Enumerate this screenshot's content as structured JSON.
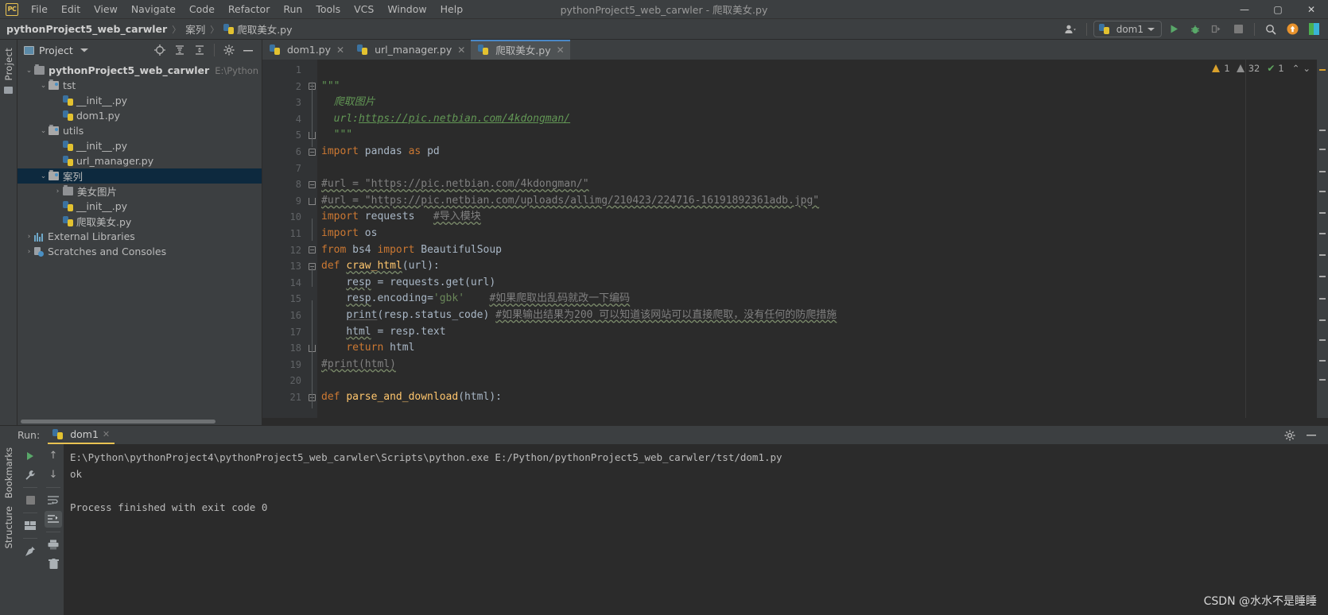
{
  "window": {
    "title": "pythonProject5_web_carwler - 爬取美女.py",
    "logo_text": "PC",
    "controls": {
      "minimize": "—",
      "maximize": "▢",
      "close": "✕"
    }
  },
  "menu": {
    "items": [
      "File",
      "Edit",
      "View",
      "Navigate",
      "Code",
      "Refactor",
      "Run",
      "Tools",
      "VCS",
      "Window",
      "Help"
    ]
  },
  "breadcrumb": {
    "project": "pythonProject5_web_carwler",
    "folder": "案列",
    "file": "爬取美女.py",
    "separator": "〉"
  },
  "toolbar": {
    "profile_icon": "user-icon",
    "run_config": "dom1",
    "run": "run-icon",
    "debug": "debug-icon",
    "coverage": "coverage-icon",
    "stop": "stop-icon",
    "search": "search-icon",
    "update": "update-icon"
  },
  "rail": {
    "project_label": "Project",
    "bookmarks_label": "Bookmarks",
    "structure_label": "Structure"
  },
  "project_panel": {
    "title": "Project",
    "header_buttons": [
      "target-icon",
      "expand-all-icon",
      "collapse-all-icon",
      "gear-icon",
      "hide-icon"
    ],
    "tree": [
      {
        "depth": 0,
        "arrow": "⌄",
        "icon": "folder",
        "label": "pythonProject5_web_carwler",
        "bold": true,
        "path": "E:\\Python\\pythonPr",
        "selected": false
      },
      {
        "depth": 1,
        "arrow": "⌄",
        "icon": "folder-src",
        "label": "tst",
        "bold": false,
        "path": "",
        "selected": false
      },
      {
        "depth": 2,
        "arrow": "",
        "icon": "python",
        "label": "__init__.py",
        "bold": false,
        "path": "",
        "selected": false
      },
      {
        "depth": 2,
        "arrow": "",
        "icon": "python",
        "label": "dom1.py",
        "bold": false,
        "path": "",
        "selected": false
      },
      {
        "depth": 1,
        "arrow": "⌄",
        "icon": "folder-src",
        "label": "utils",
        "bold": false,
        "path": "",
        "selected": false
      },
      {
        "depth": 2,
        "arrow": "",
        "icon": "python",
        "label": "__init__.py",
        "bold": false,
        "path": "",
        "selected": false
      },
      {
        "depth": 2,
        "arrow": "",
        "icon": "python",
        "label": "url_manager.py",
        "bold": false,
        "path": "",
        "selected": false
      },
      {
        "depth": 1,
        "arrow": "⌄",
        "icon": "folder-src",
        "label": "案列",
        "bold": false,
        "path": "",
        "selected": true
      },
      {
        "depth": 2,
        "arrow": "›",
        "icon": "folder",
        "label": "美女图片",
        "bold": false,
        "path": "",
        "selected": false
      },
      {
        "depth": 2,
        "arrow": "",
        "icon": "python",
        "label": "__init__.py",
        "bold": false,
        "path": "",
        "selected": false
      },
      {
        "depth": 2,
        "arrow": "",
        "icon": "python",
        "label": "爬取美女.py",
        "bold": false,
        "path": "",
        "selected": false
      },
      {
        "depth": 0,
        "arrow": "›",
        "icon": "library",
        "label": "External Libraries",
        "bold": false,
        "path": "",
        "selected": false
      },
      {
        "depth": 0,
        "arrow": "›",
        "icon": "scratch",
        "label": "Scratches and Consoles",
        "bold": false,
        "path": "",
        "selected": false
      }
    ]
  },
  "editor": {
    "tabs": [
      {
        "label": "dom1.py",
        "active": false,
        "close": "✕"
      },
      {
        "label": "url_manager.py",
        "active": false,
        "close": "✕"
      },
      {
        "label": "爬取美女.py",
        "active": true,
        "close": "✕"
      }
    ],
    "status": {
      "warnings": "1",
      "weak_warnings": "32",
      "ok": "1",
      "up_arrow": "⌃",
      "down_arrow": "⌄"
    },
    "line_numbers": [
      "1",
      "2",
      "3",
      "4",
      "5",
      "6",
      "7",
      "8",
      "9",
      "10",
      "11",
      "12",
      "13",
      "14",
      "15",
      "16",
      "17",
      "18",
      "19",
      "20",
      "21"
    ],
    "lines": [
      {
        "n": 1,
        "segments": []
      },
      {
        "n": 2,
        "segments": [
          {
            "t": "\"\"\"",
            "c": "doc"
          }
        ]
      },
      {
        "n": 3,
        "segments": [
          {
            "t": "  爬取图片",
            "c": "doc"
          }
        ]
      },
      {
        "n": 4,
        "segments": [
          {
            "t": "  url:",
            "c": "doc"
          },
          {
            "t": "https://pic.netbian.com/4kdongman/",
            "c": "doclink"
          }
        ]
      },
      {
        "n": 5,
        "segments": [
          {
            "t": "  \"\"\"",
            "c": "doc"
          }
        ]
      },
      {
        "n": 6,
        "segments": [
          {
            "t": "import",
            "c": "kw"
          },
          {
            "t": " pandas ",
            "c": "id"
          },
          {
            "t": "as",
            "c": "kw"
          },
          {
            "t": " pd",
            "c": "id"
          }
        ]
      },
      {
        "n": 7,
        "segments": []
      },
      {
        "n": 8,
        "segments": [
          {
            "t": "#url = \"https://pic.netbian.com/4kdongman/\"",
            "c": "cmt wave-g"
          }
        ]
      },
      {
        "n": 9,
        "segments": [
          {
            "t": "#url = \"https://pic.netbian.com/uploads/allimg/210423/224716-16191892361adb.jpg\"",
            "c": "cmt wave-g"
          }
        ]
      },
      {
        "n": 10,
        "segments": [
          {
            "t": "import",
            "c": "kw"
          },
          {
            "t": " requests",
            "c": "id"
          },
          {
            "t": "   ",
            "c": "id"
          },
          {
            "t": "#导入模块",
            "c": "cmt wave-g"
          }
        ]
      },
      {
        "n": 11,
        "segments": [
          {
            "t": "import",
            "c": "kw"
          },
          {
            "t": " os",
            "c": "id"
          }
        ]
      },
      {
        "n": 12,
        "segments": [
          {
            "t": "from",
            "c": "kw"
          },
          {
            "t": " bs4 ",
            "c": "id"
          },
          {
            "t": "import",
            "c": "kw"
          },
          {
            "t": " BeautifulSoup",
            "c": "id"
          }
        ]
      },
      {
        "n": 13,
        "segments": [
          {
            "t": "def",
            "c": "kw"
          },
          {
            "t": " ",
            "c": "id"
          },
          {
            "t": "craw_html",
            "c": "fn wave-g"
          },
          {
            "t": "(url):",
            "c": "id"
          }
        ]
      },
      {
        "n": 14,
        "segments": [
          {
            "t": "    ",
            "c": "id"
          },
          {
            "t": "resp",
            "c": "id wave-g"
          },
          {
            "t": " = requests.get(url)",
            "c": "id"
          }
        ]
      },
      {
        "n": 15,
        "segments": [
          {
            "t": "    ",
            "c": "id"
          },
          {
            "t": "resp",
            "c": "id wave-g"
          },
          {
            "t": ".encoding=",
            "c": "id"
          },
          {
            "t": "'gbk'",
            "c": "str"
          },
          {
            "t": "    ",
            "c": "id"
          },
          {
            "t": "#如果爬取出乱码就改一下编码",
            "c": "cmt wave-g"
          }
        ]
      },
      {
        "n": 16,
        "segments": [
          {
            "t": "    ",
            "c": "id"
          },
          {
            "t": "print",
            "c": "id ul-soft"
          },
          {
            "t": "(resp.status_code) ",
            "c": "id"
          },
          {
            "t": "#如果输出结果为200 可以知道该网站可以直接爬取，没有任何的防爬措施",
            "c": "cmt wave-g"
          }
        ]
      },
      {
        "n": 17,
        "segments": [
          {
            "t": "    ",
            "c": "id"
          },
          {
            "t": "html",
            "c": "id wave-g"
          },
          {
            "t": " = resp.text",
            "c": "id"
          }
        ]
      },
      {
        "n": 18,
        "segments": [
          {
            "t": "    ",
            "c": "id"
          },
          {
            "t": "return",
            "c": "kw"
          },
          {
            "t": " html",
            "c": "id"
          }
        ]
      },
      {
        "n": 19,
        "segments": [
          {
            "t": "#print(html)",
            "c": "cmt wave-g"
          }
        ]
      },
      {
        "n": 20,
        "segments": []
      },
      {
        "n": 21,
        "segments": [
          {
            "t": "def",
            "c": "kw"
          },
          {
            "t": " ",
            "c": "id"
          },
          {
            "t": "parse_and_download",
            "c": "fn"
          },
          {
            "t": "(html):",
            "c": "id"
          }
        ]
      }
    ]
  },
  "run_panel": {
    "label": "Run:",
    "tab": "dom1",
    "tab_close": "✕",
    "header_buttons": [
      "gear-icon",
      "hide-icon"
    ],
    "left_tools": [
      "run-icon",
      "wrench-icon",
      "stop-icon",
      "layout-icon",
      "pin-icon"
    ],
    "right_tools": [
      "up-arrow-icon",
      "down-arrow-icon",
      "soft-wrap-icon",
      "scroll-end-icon",
      "print-icon",
      "trash-icon"
    ],
    "console_lines": [
      "E:\\Python\\pythonProject4\\pythonProject5_web_carwler\\Scripts\\python.exe E:/Python/pythonProject5_web_carwler/tst/dom1.py",
      "ok",
      "",
      "Process finished with exit code 0"
    ]
  },
  "watermark": "CSDN @水水不是睡睡",
  "colors": {
    "bg_chrome": "#3c3f41",
    "bg_editor": "#2b2b2b",
    "accent_blue": "#4a88c7",
    "accent_yellow": "#e8c252",
    "selection": "#0d293e",
    "keyword": "#cc7832",
    "string": "#6a8759",
    "comment": "#808080",
    "function": "#ffc66d",
    "docstring": "#629755"
  }
}
